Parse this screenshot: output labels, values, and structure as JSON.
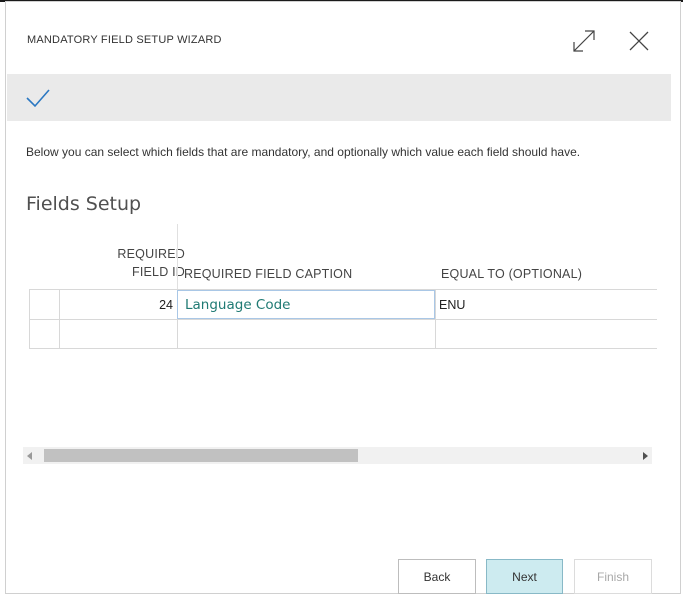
{
  "dialog": {
    "title": "MANDATORY FIELD SETUP WIZARD",
    "intro": "Below you can select which fields that are mandatory, and optionally which value each field should have.",
    "section_title": "Fields Setup"
  },
  "grid": {
    "headers": {
      "id_line1": "REQUIRED",
      "id_line2": "FIELD ID",
      "caption": "REQUIRED FIELD CAPTION",
      "equal": "EQUAL TO (OPTIONAL)"
    },
    "rows": [
      {
        "id": "24",
        "caption": "Language Code",
        "equal": "ENU"
      },
      {
        "id": "",
        "caption": "",
        "equal": ""
      }
    ]
  },
  "buttons": {
    "back": "Back",
    "next": "Next",
    "finish": "Finish"
  },
  "icons": {
    "expand": "expand-icon",
    "close": "close-icon",
    "step_done": "checkmark-icon"
  },
  "colors": {
    "accent": "#2b78c2",
    "link": "#1f7a73",
    "next_bg": "#cdebf0",
    "band": "#eaeaea"
  }
}
